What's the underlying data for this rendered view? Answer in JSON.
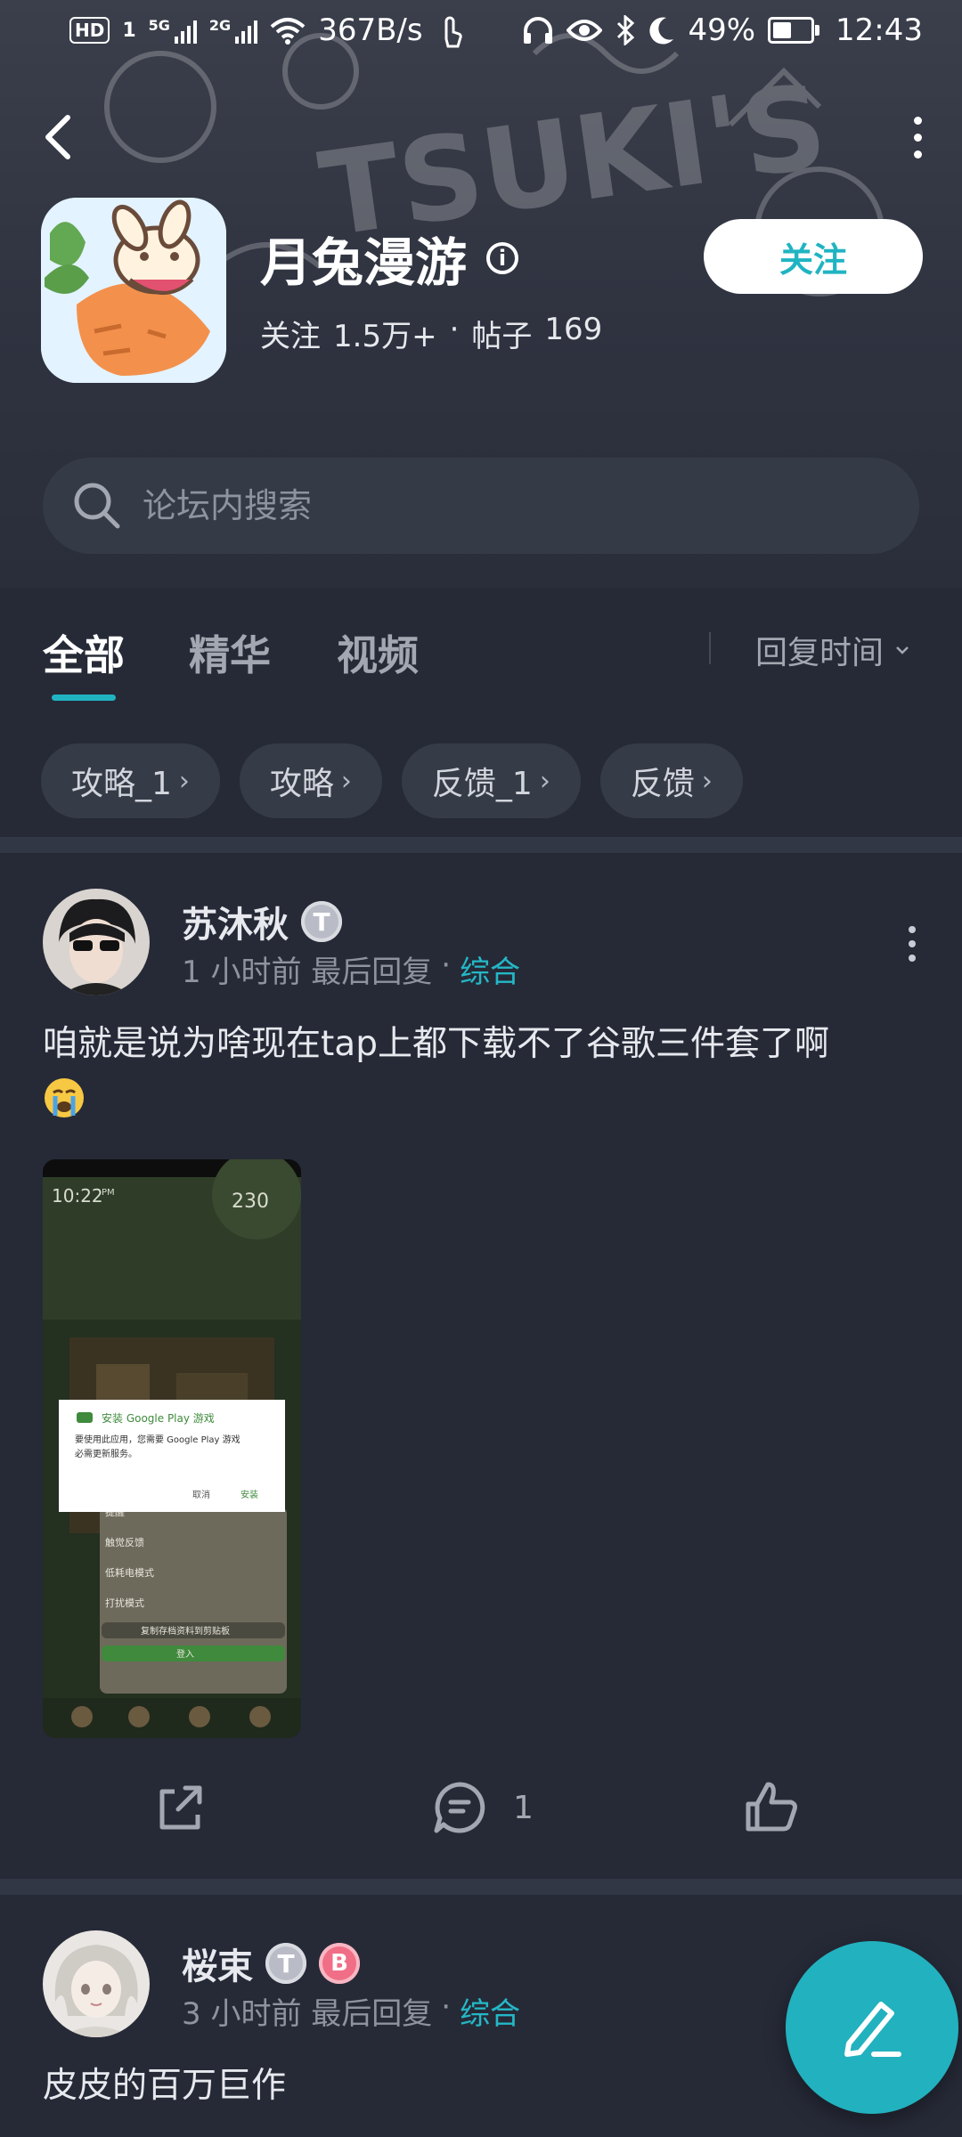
{
  "status_bar": {
    "hd": "HD",
    "sim": "1",
    "net1": "5G",
    "net2": "2G",
    "speed": "367B/s",
    "battery": "49%",
    "time": "12:43"
  },
  "forum": {
    "title": "月兔漫游",
    "follow_label": "关注",
    "followers_label": "关注",
    "followers_value": "1.5万+",
    "dot": "·",
    "posts_label": "帖子",
    "posts_value": "169",
    "header_art_text": "TSUKI'S"
  },
  "search": {
    "placeholder": "论坛内搜索"
  },
  "tabs": [
    {
      "label": "全部",
      "active": true
    },
    {
      "label": "精华",
      "active": false
    },
    {
      "label": "视频",
      "active": false
    }
  ],
  "sort": {
    "label": "回复时间"
  },
  "chips": [
    {
      "label": "攻略_1"
    },
    {
      "label": "攻略"
    },
    {
      "label": "反馈_1"
    },
    {
      "label": "反馈"
    }
  ],
  "posts": [
    {
      "author": "苏沐秋",
      "badges": [
        "T"
      ],
      "time": "1 小时前 最后回复",
      "dot": "·",
      "category": "综合",
      "text": "咱就是说为啥现在tap上都下载不了谷歌三件套了啊",
      "emoji": "crying-face",
      "screenshot": {
        "clock": "10:22",
        "clock_suffix": "PM",
        "carrots": "230",
        "dialog_title": "安装 Google Play 游戏",
        "dialog_body": "要使用此应用，您需要 Google Play 游戏",
        "dialog_body2": "必需更新服务。",
        "dialog_cancel": "取消",
        "dialog_ok": "安装",
        "menu_items": [
          "提醒",
          "触觉反馈",
          "低耗电模式",
          "打扰模式"
        ],
        "menu_link": "复制存档资料到剪贴板",
        "menu_login": "登入"
      },
      "share": "share-icon",
      "comments": "1",
      "like": "like-icon"
    },
    {
      "author": "桜束",
      "badges": [
        "T",
        "B"
      ],
      "time": "3 小时前 最后回复",
      "dot": "·",
      "category": "综合",
      "text": "皮皮的百万巨作"
    }
  ],
  "fab": {
    "icon": "compose-icon"
  },
  "colors": {
    "accent": "#20b4c2",
    "background": "#262a37",
    "header": "#2f3340"
  }
}
